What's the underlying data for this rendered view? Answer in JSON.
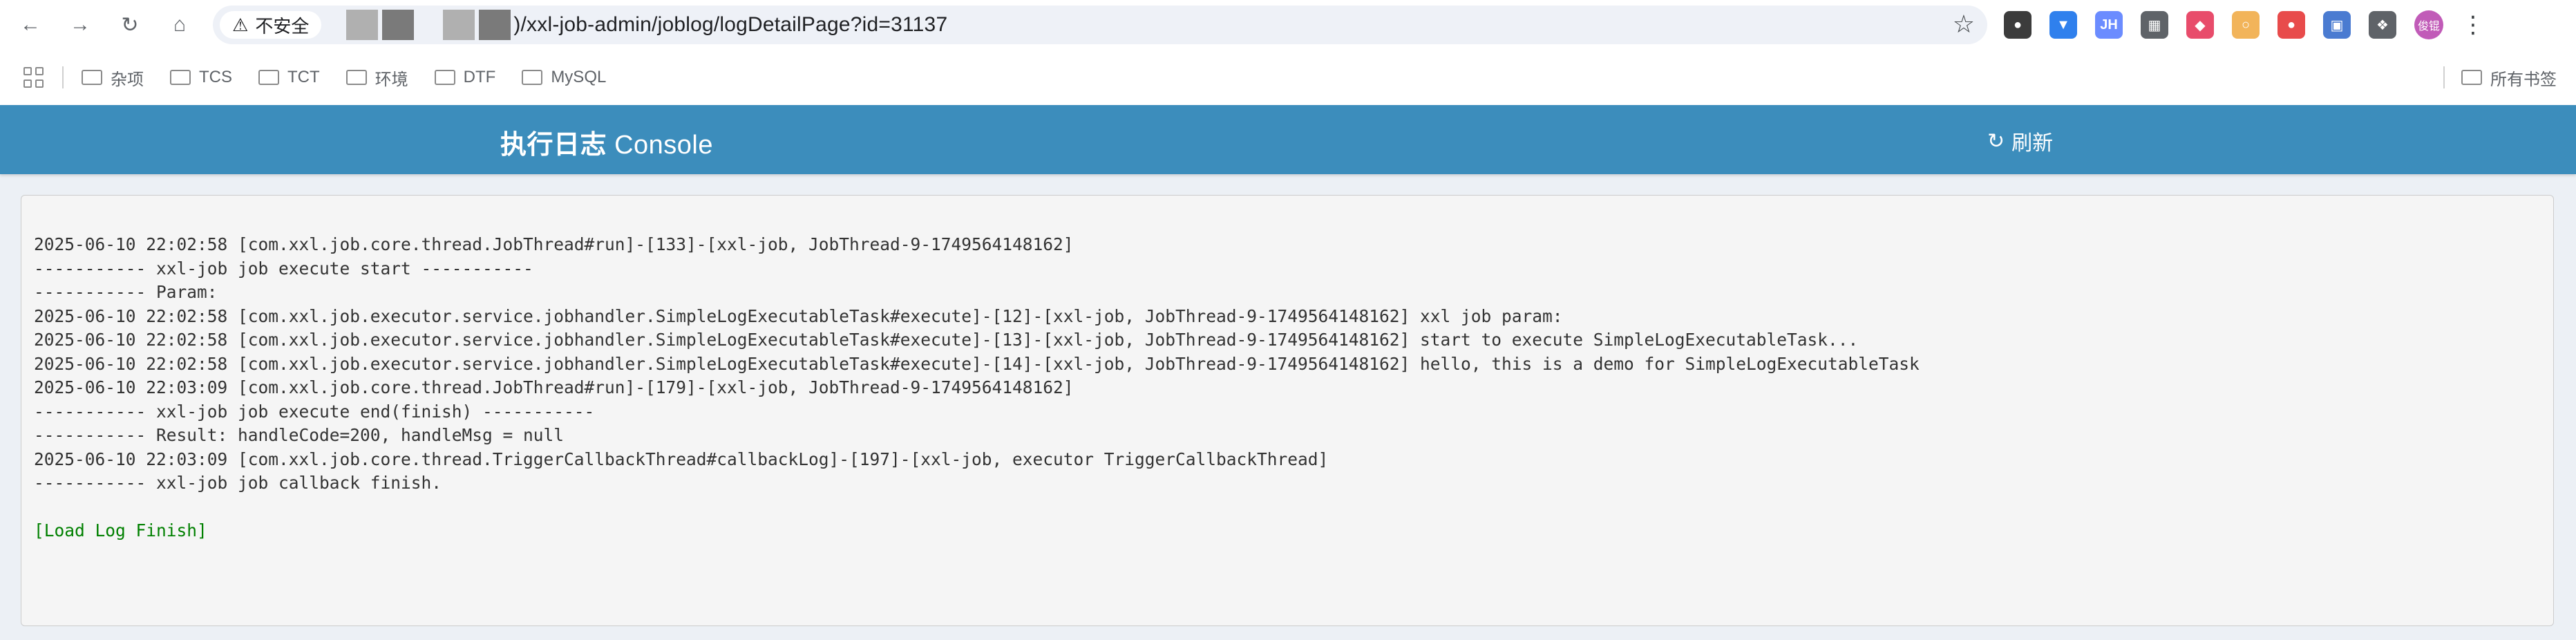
{
  "browser": {
    "security_label": "不安全",
    "url_visible": ")/xxl-job-admin/joblog/logDetailPage?id=31137",
    "nav_icons": [
      "back-icon",
      "forward-icon",
      "reload-icon",
      "home-icon"
    ],
    "avatar_text": "俊锟",
    "extensions": [
      {
        "name": "circle-extension-icon",
        "color": "#3c3c3c"
      },
      {
        "name": "vue-devtools-extension-icon",
        "color": "#2f80ed"
      },
      {
        "name": "jh-extension-icon",
        "color": "#6b8cff"
      },
      {
        "name": "qr-extension-icon",
        "color": "#5f6368"
      },
      {
        "name": "shield-extension-icon",
        "color": "#e84c6b"
      },
      {
        "name": "cookie-extension-icon",
        "color": "#f2b45a"
      },
      {
        "name": "record-extension-icon",
        "color": "#e84b4b"
      },
      {
        "name": "picture-extension-icon",
        "color": "#4a7bd1"
      },
      {
        "name": "puzzle-extension-icon",
        "color": "#5f6368"
      }
    ]
  },
  "bookmarks": {
    "items": [
      "杂项",
      "TCS",
      "TCT",
      "环境",
      "DTF",
      "MySQL"
    ],
    "all_bookmarks": "所有书签"
  },
  "header": {
    "title_bold": "执行日志",
    "title_rest": " Console",
    "refresh_label": "刷新",
    "color": "#3c8dbc"
  },
  "log": {
    "lines": [
      "2025-06-10 22:02:58 [com.xxl.job.core.thread.JobThread#run]-[133]-[xxl-job, JobThread-9-1749564148162]",
      "----------- xxl-job job execute start -----------",
      "----------- Param:",
      "2025-06-10 22:02:58 [com.xxl.job.executor.service.jobhandler.SimpleLogExecutableTask#execute]-[12]-[xxl-job, JobThread-9-1749564148162] xxl job param:",
      "2025-06-10 22:02:58 [com.xxl.job.executor.service.jobhandler.SimpleLogExecutableTask#execute]-[13]-[xxl-job, JobThread-9-1749564148162] start to execute SimpleLogExecutableTask...",
      "2025-06-10 22:02:58 [com.xxl.job.executor.service.jobhandler.SimpleLogExecutableTask#execute]-[14]-[xxl-job, JobThread-9-1749564148162] hello, this is a demo for SimpleLogExecutableTask",
      "2025-06-10 22:03:09 [com.xxl.job.core.thread.JobThread#run]-[179]-[xxl-job, JobThread-9-1749564148162]",
      "----------- xxl-job job execute end(finish) -----------",
      "----------- Result: handleCode=200, handleMsg = null",
      "2025-06-10 22:03:09 [com.xxl.job.core.thread.TriggerCallbackThread#callbackLog]-[197]-[xxl-job, executor TriggerCallbackThread]",
      "----------- xxl-job job callback finish."
    ],
    "finish": "[Load Log Finish]",
    "finish_color": "#008000"
  }
}
